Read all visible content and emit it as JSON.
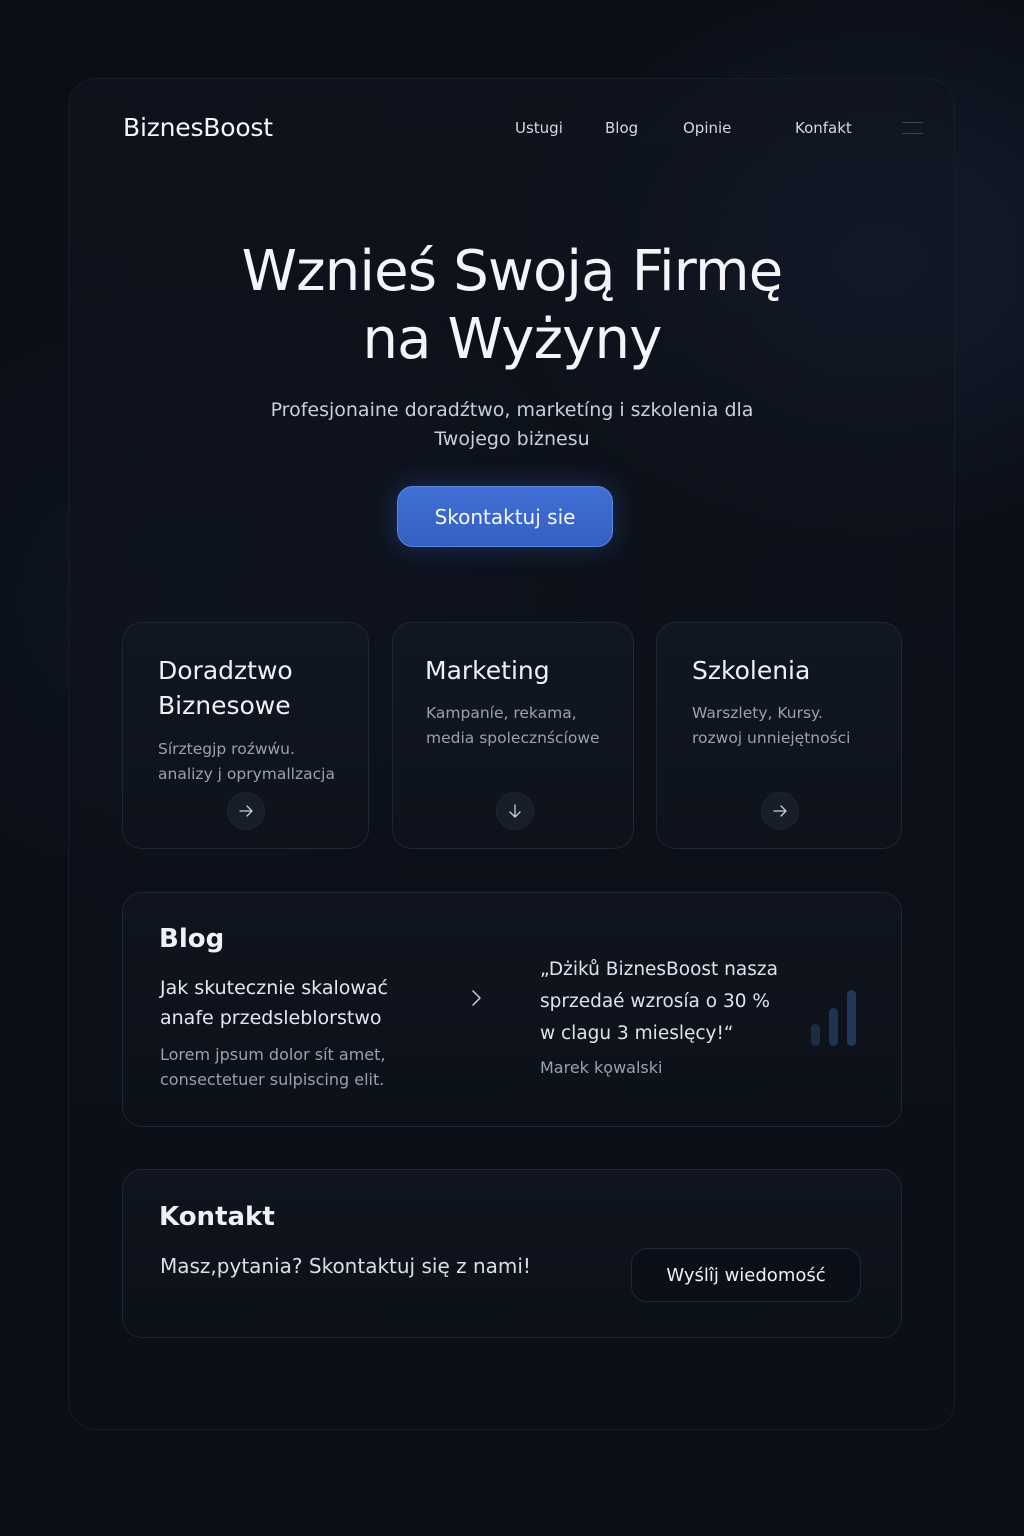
{
  "brand": {
    "name": "BiznesBoost"
  },
  "nav": {
    "items": [
      {
        "label": "Ustugi"
      },
      {
        "label": "Blog"
      },
      {
        "label": "Opinie"
      },
      {
        "label": "Konfakt"
      }
    ],
    "menu_icon": "hamburger-menu-icon"
  },
  "hero": {
    "title_line1": "Wznieś Swoją Firmę",
    "title_line2": "na Wyżyny",
    "subtitle_line1": "Profesjonaine doradźtwo, marketíng i szkolenia dla",
    "subtitle_line2": "Twojego biżnesu",
    "cta_label": "Skontaktuj sie"
  },
  "services": [
    {
      "title_line1": "Doradztwo",
      "title_line2": "Biznesowe",
      "desc_line1": "Sírztegjp roźwẃu.",
      "desc_line2": "analizy j oprymallzacja",
      "icon": "arrow-right-icon"
    },
    {
      "title_line1": "Marketing",
      "desc_line1": "Kampaníe, rekama,",
      "desc_line2": "media spolecznścíowe",
      "icon": "arrow-down-icon"
    },
    {
      "title_line1": "Szkolenia",
      "desc_line1": "Warszlety, Kursy.",
      "desc_line2": "rozwoj unniejętności",
      "icon": "arrow-right-icon"
    }
  ],
  "blog": {
    "heading": "Blog",
    "post_title_line1": "Jak skutecznie skalować",
    "post_title_line2": "anafe przedsleblorstwo",
    "excerpt_line1": "Lorem jpsum dolor sít amet,",
    "excerpt_line2": "consectetuer sulpiscing elit.",
    "chevron_icon": "chevron-right-icon"
  },
  "testimonial": {
    "quote_line1": "„Dżiků BiznesBoost nasza",
    "quote_line2": "sprzedaé wzrosía o 30 %",
    "quote_line3": "w clagu 3 mieslęcy!“",
    "author": "Marek kǫwalski",
    "icon": "bar-chart-icon"
  },
  "contact": {
    "heading": "Kontakt",
    "text": "Masz,pytania? Skontaktuj się z nami!",
    "button_label": "Wyślîj wiedomość"
  },
  "colors": {
    "background": "#0a0e16",
    "accent": "#3d6bd0",
    "card": "#111722",
    "text_muted": "#98a1b2"
  }
}
